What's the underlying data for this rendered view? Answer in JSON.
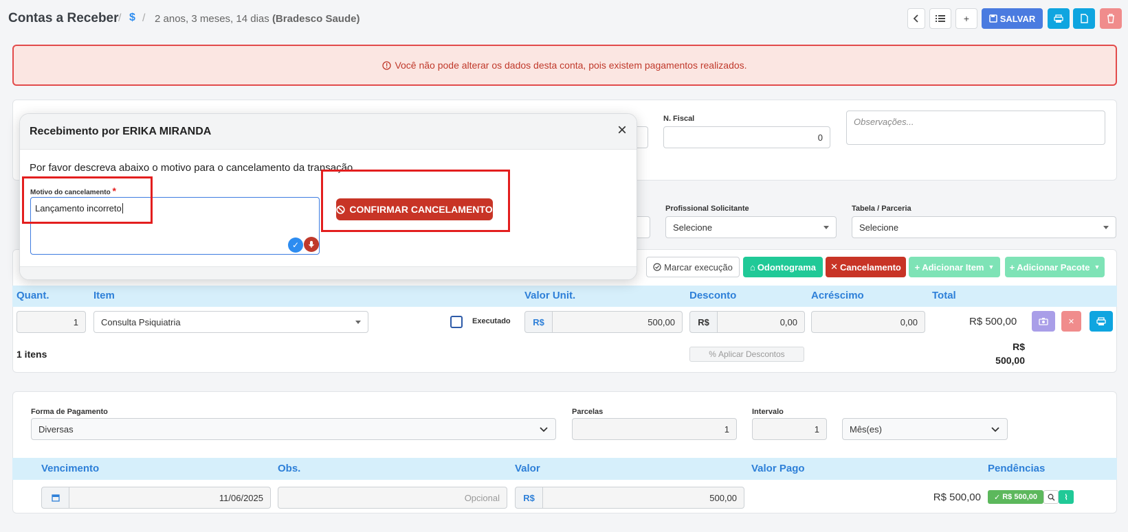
{
  "header": {
    "title": "Contas a Receber",
    "dollar": "$",
    "sep": "/",
    "breadcrumb_prefix": "2 anos, 3 meses, 14 dias ",
    "breadcrumb_bold": "(Bradesco Saude)",
    "save_label": "SALVAR"
  },
  "alert": {
    "text": "Você não pode alterar os dados desta conta, pois existem pagamentos realizados."
  },
  "top_form": {
    "nfiscal_label": "N. Fiscal",
    "nfiscal_value": "0",
    "obs_placeholder": "Observações..."
  },
  "second_form": {
    "prof_label": "Profissional Solicitante",
    "prof_value": "Selecione",
    "tabela_label": "Tabela / Parceria",
    "tabela_value": "Selecione"
  },
  "items_toolbar": {
    "marcar": "Marcar execução",
    "odonto": "Odontograma",
    "cancel": "Cancelamento",
    "add_item": "Adicionar Item",
    "add_pacote": "Adicionar Pacote"
  },
  "items_table": {
    "headers": [
      "Quant.",
      "Item",
      "Valor Unit.",
      "Desconto",
      "Acréscimo",
      "Total"
    ],
    "row": {
      "quant": "1",
      "item": "Consulta Psiquiatria",
      "executado": "Executado",
      "currency": "R$",
      "valor_unit": "500,00",
      "desconto": "0,00",
      "acrescimo": "0,00",
      "total": "R$ 500,00"
    },
    "count": "1 itens",
    "aplicar": "Aplicar Descontos",
    "sum_currency": "R$",
    "sum_value": "500,00"
  },
  "payment": {
    "forma_label": "Forma de Pagamento",
    "forma_value": "Diversas",
    "parcelas_label": "Parcelas",
    "parcelas_value": "1",
    "intervalo_label": "Intervalo",
    "intervalo_value": "1",
    "periodo_value": "Mês(es)",
    "headers": [
      "Vencimento",
      "Obs.",
      "Valor",
      "Valor Pago",
      "Pendências"
    ],
    "row": {
      "vencimento": "11/06/2025",
      "obs_placeholder": "Opcional",
      "currency": "R$",
      "valor": "500,00",
      "valor_pago": "R$ 500,00",
      "pend_badge": "R$ 500,00"
    }
  },
  "modal": {
    "title": "Recebimento por ERIKA MIRANDA",
    "close": "×",
    "description": "Por favor descreva abaixo o motivo para o cancelamento da transação.",
    "field_label": "Motivo do cancelamento",
    "required": "*",
    "field_value": "Lançamento incorreto",
    "confirm": "CONFIRMAR CANCELAMENTO"
  },
  "colors": {
    "primary": "#4a7be0",
    "cyan": "#0fa5e0",
    "danger": "#c83426",
    "success": "#20c997",
    "alert_bg": "#fbe6e2"
  }
}
